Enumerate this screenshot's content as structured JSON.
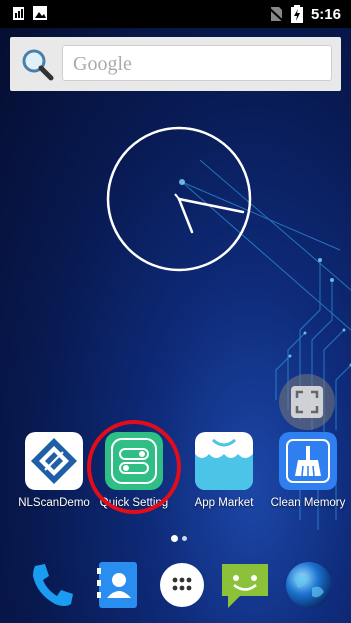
{
  "status_bar": {
    "time": "5:16",
    "left_icons": [
      "sim-notification-icon",
      "image-notification-icon"
    ],
    "right_icons": [
      "no-sim-icon",
      "battery-charging-icon"
    ]
  },
  "search_widget": {
    "placeholder": "Google",
    "icon": "magnifier-icon"
  },
  "clock_widget": {
    "type": "analog-clock",
    "time": "5:16"
  },
  "apps": [
    {
      "label": "NLScanDemo",
      "icon": "nlscan-logo-icon"
    },
    {
      "label": "Quick Setting",
      "icon": "quick-setting-toggle-icon",
      "highlighted": true
    },
    {
      "label": "App Market",
      "icon": "shopping-bag-icon"
    },
    {
      "label": "Clean Memory",
      "icon": "broom-icon"
    }
  ],
  "floating_button": {
    "icon": "screenshot-frame-icon"
  },
  "page_indicator": {
    "pages": 2,
    "current": 1
  },
  "dock": [
    {
      "name": "phone",
      "icon": "phone-icon"
    },
    {
      "name": "contacts",
      "icon": "contacts-icon"
    },
    {
      "name": "all-apps",
      "icon": "app-drawer-icon"
    },
    {
      "name": "messaging",
      "icon": "messaging-icon"
    },
    {
      "name": "browser",
      "icon": "globe-icon"
    }
  ],
  "colors": {
    "highlight_ring": "#e30c1b",
    "status_bar": "#000000",
    "quick_setting_green": "#2fbf85",
    "clean_memory_blue": "#2f7ff0"
  }
}
